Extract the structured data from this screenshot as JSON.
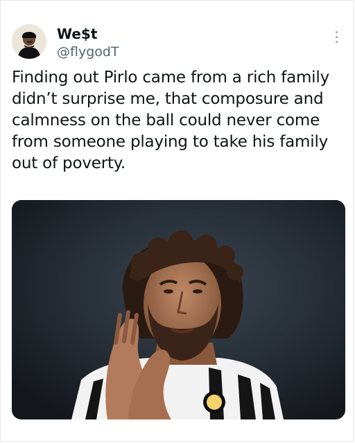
{
  "tweet": {
    "display_name": "We$t",
    "handle": "@flygodT",
    "text": "Finding out Pirlo came from a rich family didn’t surprise me, that composure and calmness on the ball could never come from someone playing to take his family out of poverty.",
    "more_icon": "more-vertical-icon",
    "avatar_icon": "profile-avatar",
    "media_icon": "photo"
  },
  "colors": {
    "text": "#0f1419",
    "secondary_text": "#536471",
    "background": "#ffffff"
  }
}
